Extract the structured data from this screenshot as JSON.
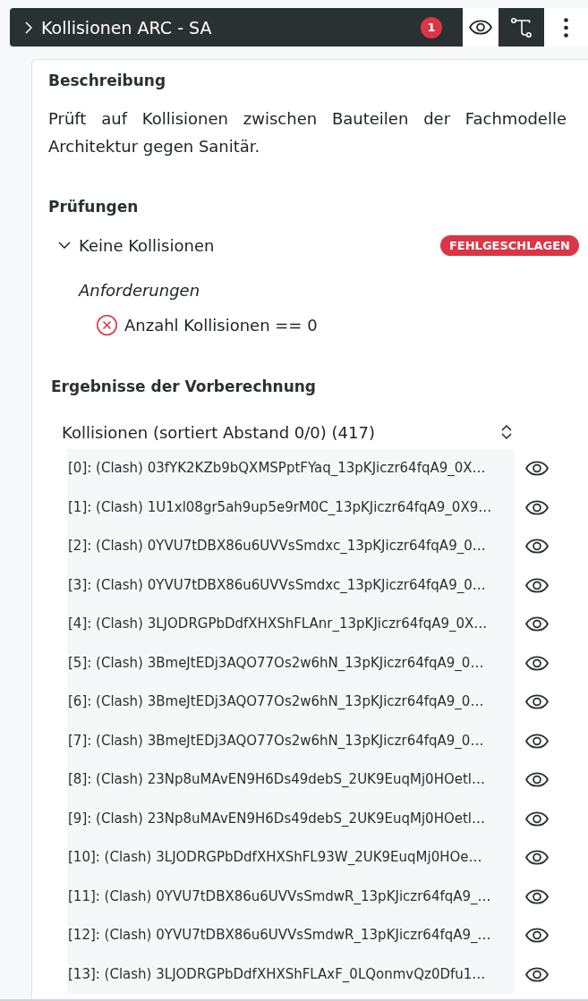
{
  "header": {
    "title": "Kollisionen ARC - SA",
    "expanded": false,
    "badge": "1"
  },
  "toolbar": [
    {
      "kind": "eye",
      "active": false
    },
    {
      "kind": "connector",
      "active": true
    },
    {
      "kind": "more",
      "active": false
    }
  ],
  "description": {
    "heading": "Beschreibung",
    "text": "Prüft auf Kollisionen zwischen Bauteilen der Fachmodelle Architektur gegen Sanitär."
  },
  "checks": {
    "heading": "Prüfungen",
    "items": [
      {
        "name": "Keine Kollisionen",
        "expanded": true,
        "passed": false,
        "status": "FEHLGESCHLAGEN",
        "requirements_heading": "Anforderungen",
        "requirements": [
          {
            "text": "Anzahl Kollisionen == 0",
            "passed": false
          }
        ]
      }
    ]
  },
  "precalculation": {
    "heading": "Ergebnisse der Vorberechnung",
    "list": {
      "title": "Kollisionen (sortiert Abstand 0/0) (417)",
      "rows": [
        {
          "label": "[0]: (Clash) 03fYK2KZb9bQXMSPptFYaq_13pKJiczr64fqA9_0X…"
        },
        {
          "label": "[1]: (Clash) 1U1xl08gr5ah9up5e9rM0C_13pKJiczr64fqA9_0X9…"
        },
        {
          "label": "[2]: (Clash) 0YVU7tDBX86u6UVVsSmdxc_13pKJiczr64fqA9_0…"
        },
        {
          "label": "[3]: (Clash) 0YVU7tDBX86u6UVVsSmdxc_13pKJiczr64fqA9_0…"
        },
        {
          "label": "[4]: (Clash) 3LJODRGPbDdfXHXShFLAnr_13pKJiczr64fqA9_0X…"
        },
        {
          "label": "[5]: (Clash) 3BmeJtEDj3AQO77Os2w6hN_13pKJiczr64fqA9_0…"
        },
        {
          "label": "[6]: (Clash) 3BmeJtEDj3AQO77Os2w6hN_13pKJiczr64fqA9_0…"
        },
        {
          "label": "[7]: (Clash) 3BmeJtEDj3AQO77Os2w6hN_13pKJiczr64fqA9_0…"
        },
        {
          "label": "[8]: (Clash) 23Np8uMAvEN9H6Ds49debS_2UK9EuqMj0HOetl…"
        },
        {
          "label": "[9]: (Clash) 23Np8uMAvEN9H6Ds49debS_2UK9EuqMj0HOetl…"
        },
        {
          "label": "[10]: (Clash) 3LJODRGPbDdfXHXShFL93W_2UK9EuqMj0HOe…"
        },
        {
          "label": "[11]: (Clash) 0YVU7tDBX86u6UVVsSmdwR_13pKJiczr64fqA9_…"
        },
        {
          "label": "[12]: (Clash) 0YVU7tDBX86u6UVVsSmdwR_13pKJiczr64fqA9_…"
        },
        {
          "label": "[13]: (Clash) 3LJODRGPbDdfXHXShFLAxF_0LQonmvQz0Dfu1…"
        }
      ]
    }
  }
}
